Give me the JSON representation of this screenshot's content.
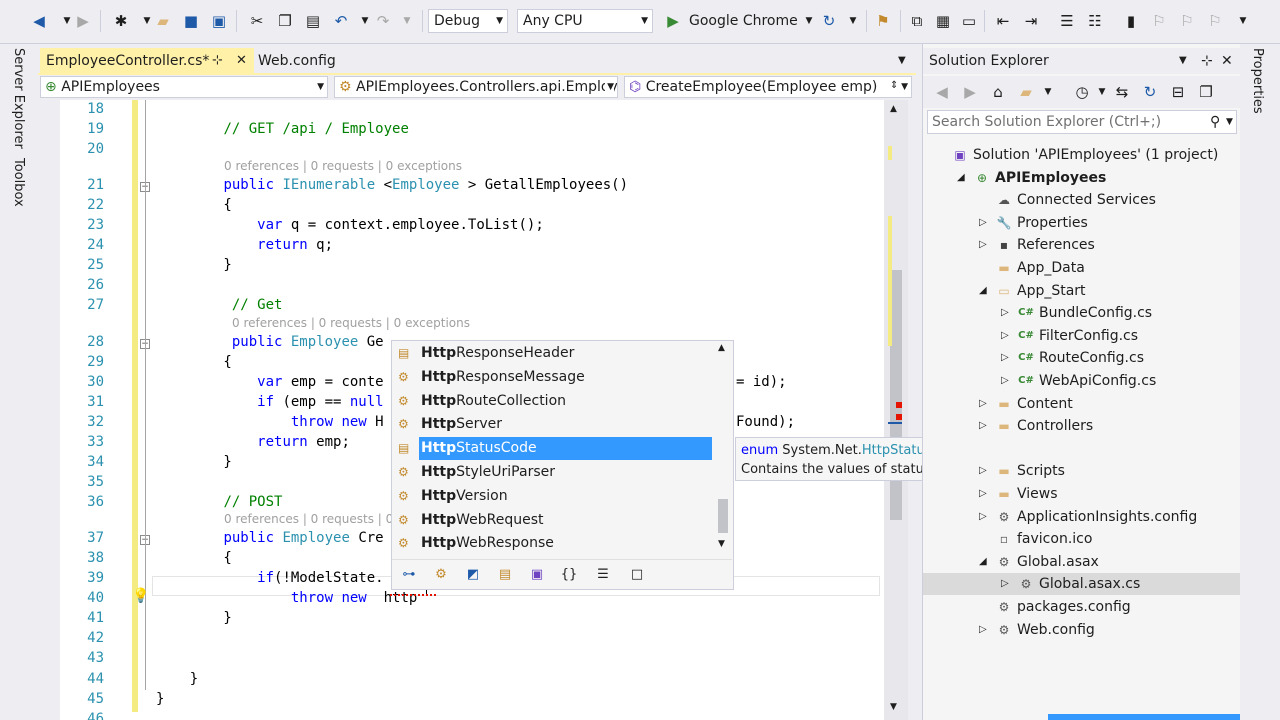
{
  "toolbar": {
    "config": "Debug",
    "platform": "Any CPU",
    "run_target": "Google Chrome",
    "icons": [
      "back-icon",
      "forward-icon",
      "new-project-icon",
      "open-icon",
      "save-icon",
      "save-all-icon",
      "cut-icon",
      "copy-icon",
      "paste-icon",
      "undo-icon",
      "redo-icon",
      "run-icon",
      "refresh-icon",
      "find-icon",
      "bookmark-icon"
    ]
  },
  "left_strip": {
    "server_explorer": "Server Explorer",
    "toolbox": "Toolbox"
  },
  "right_strip": {
    "properties": "Properties"
  },
  "tabs": [
    {
      "label": "EmployeeController.cs*",
      "active": true
    },
    {
      "label": "Web.config",
      "active": false
    }
  ],
  "navbar": {
    "project": "APIEmployees",
    "class": "APIEmployees.Controllers.api.Employ",
    "member": "CreateEmployee(Employee emp)"
  },
  "code": {
    "lines": [
      {
        "n": "18",
        "segs": []
      },
      {
        "n": "19",
        "segs": [
          {
            "t": "        ",
            "c": ""
          },
          {
            "t": "// GET /api / Employee",
            "c": "cmt"
          }
        ]
      },
      {
        "n": "20",
        "segs": []
      },
      {
        "n": "21",
        "segs": [
          {
            "t": "        ",
            "c": ""
          },
          {
            "t": "public",
            "c": "kw"
          },
          {
            "t": " ",
            "c": ""
          },
          {
            "t": "IEnumerable",
            "c": "ty"
          },
          {
            "t": " <",
            "c": ""
          },
          {
            "t": "Employee",
            "c": "ty"
          },
          {
            "t": " > GetallEmployees()",
            "c": ""
          }
        ]
      },
      {
        "n": "22",
        "segs": [
          {
            "t": "        {",
            "c": ""
          }
        ]
      },
      {
        "n": "23",
        "segs": [
          {
            "t": "            ",
            "c": ""
          },
          {
            "t": "var",
            "c": "kw"
          },
          {
            "t": " q = context.employee.ToList();",
            "c": ""
          }
        ]
      },
      {
        "n": "24",
        "segs": [
          {
            "t": "            ",
            "c": ""
          },
          {
            "t": "return",
            "c": "kw"
          },
          {
            "t": " q;",
            "c": ""
          }
        ]
      },
      {
        "n": "25",
        "segs": [
          {
            "t": "        }",
            "c": ""
          }
        ]
      },
      {
        "n": "26",
        "segs": []
      },
      {
        "n": "27",
        "segs": [
          {
            "t": "         ",
            "c": ""
          },
          {
            "t": "// Get",
            "c": "cmt"
          }
        ]
      },
      {
        "n": "28",
        "segs": [
          {
            "t": "         ",
            "c": ""
          },
          {
            "t": "public",
            "c": "kw"
          },
          {
            "t": " ",
            "c": ""
          },
          {
            "t": "Employee",
            "c": "ty"
          },
          {
            "t": " Ge",
            "c": ""
          }
        ]
      },
      {
        "n": "29",
        "segs": [
          {
            "t": "        {",
            "c": ""
          }
        ]
      },
      {
        "n": "30",
        "segs": [
          {
            "t": "            ",
            "c": ""
          },
          {
            "t": "var",
            "c": "kw"
          },
          {
            "t": " emp = conte",
            "c": ""
          }
        ]
      },
      {
        "n": "31",
        "segs": [
          {
            "t": "            ",
            "c": ""
          },
          {
            "t": "if",
            "c": "kw"
          },
          {
            "t": " (emp == ",
            "c": ""
          },
          {
            "t": "null",
            "c": "kw"
          }
        ]
      },
      {
        "n": "32",
        "segs": [
          {
            "t": "                ",
            "c": ""
          },
          {
            "t": "throw",
            "c": "kw"
          },
          {
            "t": " ",
            "c": ""
          },
          {
            "t": "new",
            "c": "kw"
          },
          {
            "t": " H",
            "c": ""
          }
        ]
      },
      {
        "n": "33",
        "segs": [
          {
            "t": "            ",
            "c": ""
          },
          {
            "t": "return",
            "c": "kw"
          },
          {
            "t": " emp;",
            "c": ""
          }
        ]
      },
      {
        "n": "34",
        "segs": [
          {
            "t": "        }",
            "c": ""
          }
        ]
      },
      {
        "n": "35",
        "segs": []
      },
      {
        "n": "36",
        "segs": [
          {
            "t": "        ",
            "c": ""
          },
          {
            "t": "// POST",
            "c": "cmt"
          }
        ]
      },
      {
        "n": "37",
        "segs": [
          {
            "t": "        ",
            "c": ""
          },
          {
            "t": "public",
            "c": "kw"
          },
          {
            "t": " ",
            "c": ""
          },
          {
            "t": "Employee",
            "c": "ty"
          },
          {
            "t": " Cre",
            "c": ""
          }
        ]
      },
      {
        "n": "38",
        "segs": [
          {
            "t": "        {",
            "c": ""
          }
        ]
      },
      {
        "n": "39",
        "segs": [
          {
            "t": "            ",
            "c": ""
          },
          {
            "t": "if",
            "c": "kw"
          },
          {
            "t": "(!ModelState.",
            "c": ""
          }
        ]
      },
      {
        "n": "40",
        "segs": [
          {
            "t": "                ",
            "c": ""
          },
          {
            "t": "throw",
            "c": "kw"
          },
          {
            "t": " ",
            "c": ""
          },
          {
            "t": "new",
            "c": "kw"
          },
          {
            "t": "  http",
            "c": ""
          }
        ]
      },
      {
        "n": "41",
        "segs": [
          {
            "t": "        }",
            "c": ""
          }
        ]
      },
      {
        "n": "42",
        "segs": []
      },
      {
        "n": "43",
        "segs": []
      },
      {
        "n": "44",
        "segs": [
          {
            "t": "    }",
            "c": ""
          }
        ]
      },
      {
        "n": "45",
        "segs": [
          {
            "t": "}",
            "c": ""
          }
        ]
      },
      {
        "n": "46",
        "segs": []
      }
    ],
    "lens": [
      {
        "line": "21",
        "text": "0 references | 0 requests | 0 exceptions"
      },
      {
        "line": "28",
        "text": "0 references | 0 requests | 0 exceptions"
      },
      {
        "line": "37",
        "text": "0 references | 0 requests | 0"
      }
    ],
    "right_fragments": [
      {
        "line": "30",
        "text": "= id);"
      },
      {
        "line": "32",
        "text": "Found);"
      }
    ]
  },
  "completion": {
    "typed": "Http",
    "items": [
      {
        "bold": "Http",
        "rest": "ResponseHeader",
        "icon": "enum-icon"
      },
      {
        "bold": "Http",
        "rest": "ResponseMessage",
        "icon": "class-icon"
      },
      {
        "bold": "Http",
        "rest": "RouteCollection",
        "icon": "class-icon"
      },
      {
        "bold": "Http",
        "rest": "Server",
        "icon": "class-icon"
      },
      {
        "bold": "Http",
        "rest": "StatusCode",
        "icon": "enum-icon",
        "selected": true
      },
      {
        "bold": "Http",
        "rest": "StyleUriParser",
        "icon": "class-icon"
      },
      {
        "bold": "Http",
        "rest": "Version",
        "icon": "class-icon"
      },
      {
        "bold": "Http",
        "rest": "WebRequest",
        "icon": "class-icon"
      },
      {
        "bold": "Http",
        "rest": "WebResponse",
        "icon": "class-icon"
      }
    ]
  },
  "tooltip": {
    "kind": "enum",
    "namespace": "System.Net.",
    "type": "HttpStatusCode",
    "description": "Contains the values of status codes defined for HTTP."
  },
  "solution_explorer": {
    "title": "Solution Explorer",
    "search_placeholder": "Search Solution Explorer (Ctrl+;)",
    "nodes": [
      {
        "label": "Solution 'APIEmployees' (1 project)",
        "level": 0,
        "expander": "",
        "icon": "solution-icon"
      },
      {
        "label": "APIEmployees",
        "level": 1,
        "expander": "expanded",
        "icon": "web-project-icon",
        "bold": true
      },
      {
        "label": "Connected Services",
        "level": 2,
        "expander": "",
        "icon": "connected-services-icon"
      },
      {
        "label": "Properties",
        "level": 2,
        "expander": "collapsed",
        "icon": "wrench-icon"
      },
      {
        "label": "References",
        "level": 2,
        "expander": "collapsed",
        "icon": "references-icon"
      },
      {
        "label": "App_Data",
        "level": 2,
        "expander": "",
        "icon": "folder-icon"
      },
      {
        "label": "App_Start",
        "level": 2,
        "expander": "expanded",
        "icon": "folder-open-icon"
      },
      {
        "label": "BundleConfig.cs",
        "level": 3,
        "expander": "collapsed",
        "icon": "csharp-icon"
      },
      {
        "label": "FilterConfig.cs",
        "level": 3,
        "expander": "collapsed",
        "icon": "csharp-icon"
      },
      {
        "label": "RouteConfig.cs",
        "level": 3,
        "expander": "collapsed",
        "icon": "csharp-icon"
      },
      {
        "label": "WebApiConfig.cs",
        "level": 3,
        "expander": "collapsed",
        "icon": "csharp-icon"
      },
      {
        "label": "Content",
        "level": 2,
        "expander": "collapsed",
        "icon": "folder-icon"
      },
      {
        "label": "Controllers",
        "level": 2,
        "expander": "collapsed",
        "icon": "folder-icon"
      },
      {
        "label": "",
        "level": 2,
        "expander": "",
        "icon": ""
      },
      {
        "label": "Scripts",
        "level": 2,
        "expander": "collapsed",
        "icon": "folder-icon"
      },
      {
        "label": "Views",
        "level": 2,
        "expander": "collapsed",
        "icon": "folder-icon"
      },
      {
        "label": "ApplicationInsights.config",
        "level": 2,
        "expander": "collapsed",
        "icon": "config-icon"
      },
      {
        "label": "favicon.ico",
        "level": 2,
        "expander": "",
        "icon": "image-file-icon"
      },
      {
        "label": "Global.asax",
        "level": 2,
        "expander": "expanded",
        "icon": "config-icon"
      },
      {
        "label": "Global.asax.cs",
        "level": 3,
        "expander": "collapsed",
        "icon": "code-file-icon",
        "selected": true
      },
      {
        "label": "packages.config",
        "level": 2,
        "expander": "",
        "icon": "config-icon"
      },
      {
        "label": "Web.config",
        "level": 2,
        "expander": "collapsed",
        "icon": "config-icon"
      }
    ]
  }
}
